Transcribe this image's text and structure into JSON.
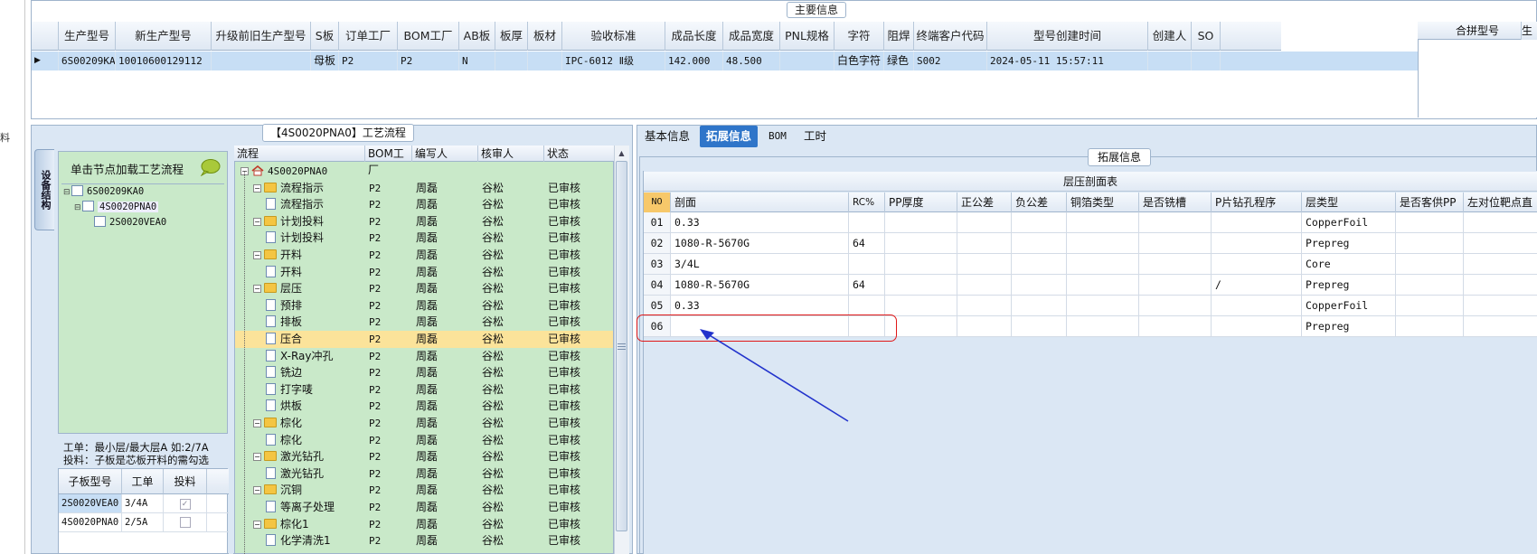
{
  "top": {
    "caption": "主要信息",
    "columns": [
      "生产型号",
      "新生产型号",
      "升级前旧生产型号",
      "S板",
      "订单工厂",
      "BOM工厂",
      "AB板",
      "板厚",
      "板材",
      "验收标准",
      "成品长度",
      "成品宽度",
      "PNL规格",
      "字符",
      "阻焊",
      "终端客户代码",
      "型号创建时间",
      "创建人",
      "SO"
    ],
    "row": {
      "sel_marker": "▶",
      "生产型号": "6S00209KA0",
      "新生产型号": "10010600129112",
      "S板": "母板",
      "订单工厂": "P2",
      "BOM工厂": "P2",
      "AB板": "N",
      "验收标准": "IPC-6012 Ⅱ级",
      "成品长度": "142.000",
      "成品宽度": "48.500",
      "字符": "白色字符",
      "阻焊": "绿色",
      "终端客户代码": "S002",
      "型号创建时间": "2024-05-11 15:57:11"
    },
    "right_header": "合拼型号",
    "right_header2": "生"
  },
  "outer_left_label": "料",
  "process": {
    "caption": "【4S0020PNA0】工艺流程",
    "vertical_tab": "设备结构",
    "node_hint": "单击节点加载工艺流程",
    "tree": [
      "6S00209KA0",
      "4S0020PNA0",
      "2S0020VEA0"
    ],
    "note1": "工单：最小层/最大层A 如:2/7A",
    "note2": "投料：子板是芯板开料的需勾选",
    "sub_table": {
      "headers": [
        "子板型号",
        "工单",
        "投料"
      ],
      "rows": [
        {
          "model": "2S0020VEA0",
          "order": "3/4A",
          "check": "✓"
        },
        {
          "model": "4S0020PNA0",
          "order": "2/5A",
          "check": ""
        }
      ]
    },
    "flow_headers": [
      "流程",
      "BOM工厂",
      "编写人",
      "核审人",
      "状态"
    ],
    "flow_root": "4S0020PNA0",
    "flow_rows": [
      {
        "name": "流程指示",
        "bom": "P2",
        "author": "周磊",
        "reviewer": "谷松",
        "status": "已审核"
      },
      {
        "name": "流程指示",
        "bom": "P2",
        "author": "周磊",
        "reviewer": "谷松",
        "status": "已审核"
      },
      {
        "name": "计划投料",
        "bom": "P2",
        "author": "周磊",
        "reviewer": "谷松",
        "status": "已审核"
      },
      {
        "name": "计划投料",
        "bom": "P2",
        "author": "周磊",
        "reviewer": "谷松",
        "status": "已审核"
      },
      {
        "name": "开料",
        "bom": "P2",
        "author": "周磊",
        "reviewer": "谷松",
        "status": "已审核"
      },
      {
        "name": "开料",
        "bom": "P2",
        "author": "周磊",
        "reviewer": "谷松",
        "status": "已审核"
      },
      {
        "name": "层压",
        "bom": "P2",
        "author": "周磊",
        "reviewer": "谷松",
        "status": "已审核"
      },
      {
        "name": "预排",
        "bom": "P2",
        "author": "周磊",
        "reviewer": "谷松",
        "status": "已审核"
      },
      {
        "name": "排板",
        "bom": "P2",
        "author": "周磊",
        "reviewer": "谷松",
        "status": "已审核"
      },
      {
        "name": "压合",
        "bom": "P2",
        "author": "周磊",
        "reviewer": "谷松",
        "status": "已审核"
      },
      {
        "name": "X-Ray冲孔",
        "bom": "P2",
        "author": "周磊",
        "reviewer": "谷松",
        "status": "已审核"
      },
      {
        "name": "铣边",
        "bom": "P2",
        "author": "周磊",
        "reviewer": "谷松",
        "status": "已审核"
      },
      {
        "name": "打字唛",
        "bom": "P2",
        "author": "周磊",
        "reviewer": "谷松",
        "status": "已审核"
      },
      {
        "name": "烘板",
        "bom": "P2",
        "author": "周磊",
        "reviewer": "谷松",
        "status": "已审核"
      },
      {
        "name": "棕化",
        "bom": "P2",
        "author": "周磊",
        "reviewer": "谷松",
        "status": "已审核"
      },
      {
        "name": "棕化",
        "bom": "P2",
        "author": "周磊",
        "reviewer": "谷松",
        "status": "已审核"
      },
      {
        "name": "激光钻孔",
        "bom": "P2",
        "author": "周磊",
        "reviewer": "谷松",
        "status": "已审核"
      },
      {
        "name": "激光钻孔",
        "bom": "P2",
        "author": "周磊",
        "reviewer": "谷松",
        "status": "已审核"
      },
      {
        "name": "沉铜",
        "bom": "P2",
        "author": "周磊",
        "reviewer": "谷松",
        "status": "已审核"
      },
      {
        "name": "等离子处理",
        "bom": "P2",
        "author": "周磊",
        "reviewer": "谷松",
        "status": "已审核"
      },
      {
        "name": "棕化1",
        "bom": "P2",
        "author": "周磊",
        "reviewer": "谷松",
        "status": "已审核"
      },
      {
        "name": "化学清洗1",
        "bom": "P2",
        "author": "周磊",
        "reviewer": "谷松",
        "status": "已审核"
      }
    ]
  },
  "detail": {
    "tabs": [
      "基本信息",
      "拓展信息",
      "BOM",
      "工时"
    ],
    "ext_caption": "拓展信息",
    "lam_title": "层压剖面表",
    "lam_headers": [
      "NO",
      "剖面",
      "RC%",
      "PP厚度",
      "正公差",
      "负公差",
      "铜箔类型",
      "是否铣槽",
      "P片钻孔程序",
      "层类型",
      "是否客供PP",
      "左对位靶点直"
    ],
    "lam_rows": [
      {
        "no": "01",
        "section": "0.33",
        "rc": "",
        "drill": "",
        "type": "CopperFoil"
      },
      {
        "no": "02",
        "section": "1080-R-5670G",
        "rc": "64",
        "drill": "",
        "type": "Prepreg"
      },
      {
        "no": "03",
        "section": "3/4L",
        "rc": "",
        "drill": "",
        "type": "Core"
      },
      {
        "no": "04",
        "section": "1080-R-5670G",
        "rc": "64",
        "drill": "/",
        "type": "Prepreg"
      },
      {
        "no": "05",
        "section": "0.33",
        "rc": "",
        "drill": "",
        "type": "CopperFoil"
      },
      {
        "no": "06",
        "section": "",
        "rc": "",
        "drill": "",
        "type": "Prepreg"
      }
    ]
  },
  "colors": {
    "accent": "#2f75c9",
    "green_bg": "#c9e9c9",
    "selected_row": "#fbe39a",
    "highlight": "#e01818",
    "arrow": "#2233cc"
  }
}
